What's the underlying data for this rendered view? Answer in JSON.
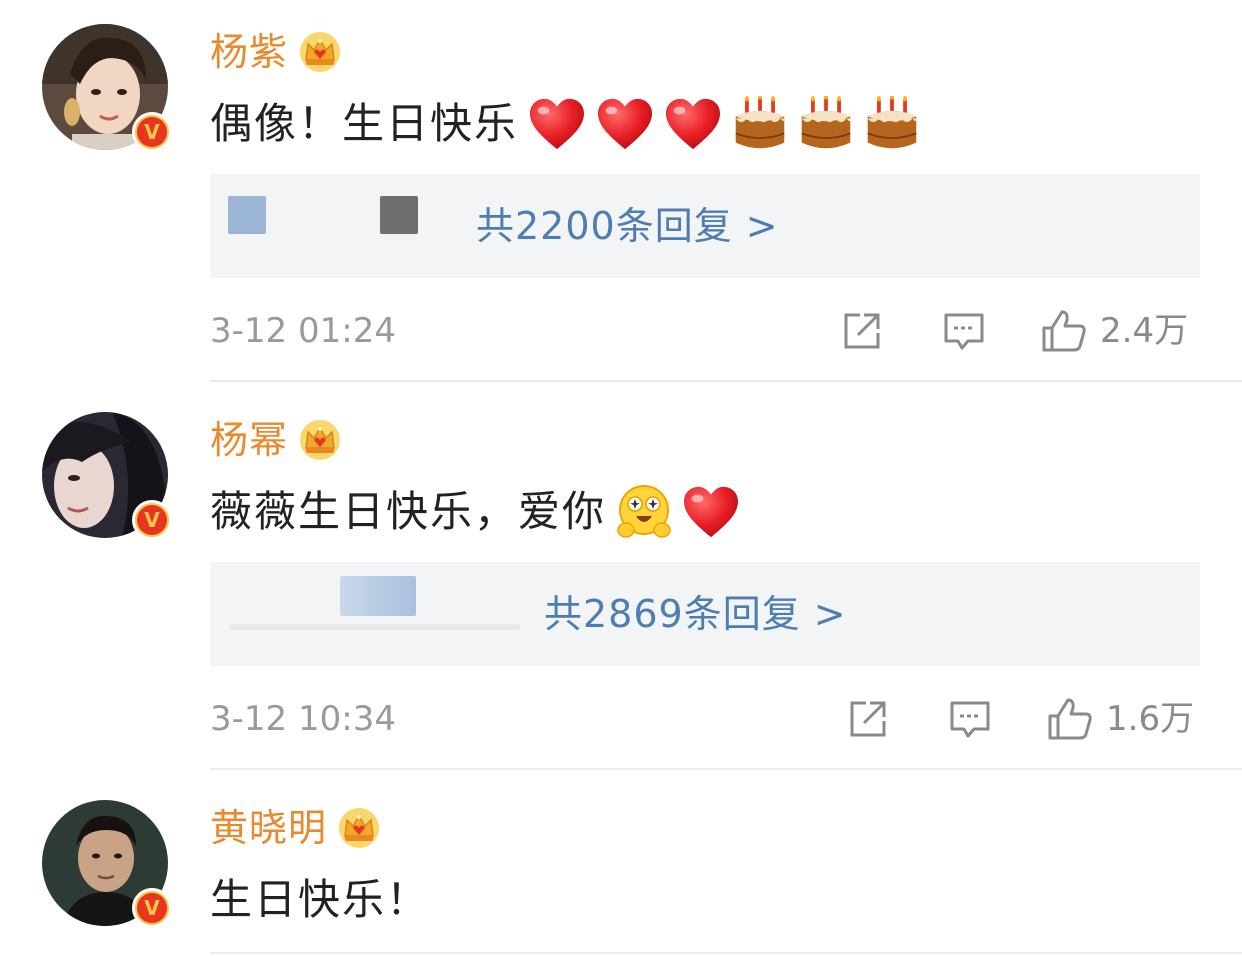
{
  "colors": {
    "username": "#e88a2e",
    "reply_link": "#4d7db1",
    "reply_box_bg": "#f3f4f5",
    "meta_text": "#9a9a9a",
    "badge_red": "#e8351f",
    "badge_gold": "#f7c64a"
  },
  "comments": [
    {
      "username": "杨紫",
      "text": "偶像！生日快乐",
      "emoji": [
        "red-heart-emoji",
        "red-heart-emoji",
        "red-heart-emoji",
        "birthday-cake-emoji",
        "birthday-cake-emoji",
        "birthday-cake-emoji"
      ],
      "reply_count_text": "共2200条回复 >",
      "timestamp": "3-12 01:24",
      "like_count": "2.4万"
    },
    {
      "username": "杨幂",
      "text": "薇薇生日快乐，爱你",
      "emoji": [
        "starstruck-hug-emoji",
        "red-heart-emoji"
      ],
      "reply_count_text": "共2869条回复 >",
      "timestamp": "3-12 10:34",
      "like_count": "1.6万"
    },
    {
      "username": "黄晓明",
      "text": "生日快乐！",
      "emoji": []
    }
  ],
  "badges": {
    "verified_letter": "V",
    "member_icon": "crown-icon"
  }
}
